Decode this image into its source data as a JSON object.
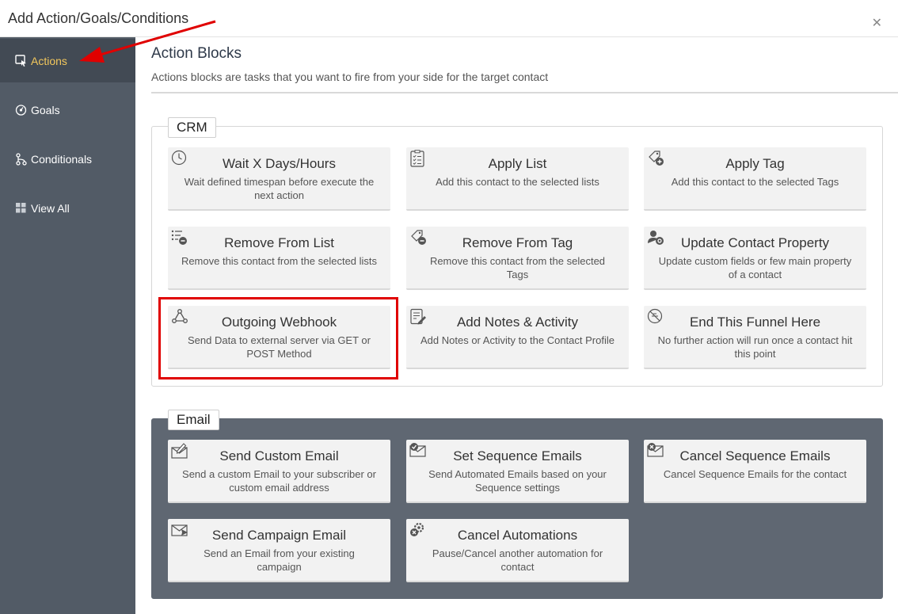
{
  "window": {
    "title": "Add Action/Goals/Conditions",
    "close_icon": "close-icon"
  },
  "sidebar": {
    "items": [
      {
        "label": "Actions",
        "icon": "action-icon",
        "active": true
      },
      {
        "label": "Goals",
        "icon": "goal-icon",
        "active": false
      },
      {
        "label": "Conditionals",
        "icon": "conditional-icon",
        "active": false
      },
      {
        "label": "View All",
        "icon": "grid-icon",
        "active": false
      }
    ]
  },
  "main": {
    "title": "Action Blocks",
    "subtitle": "Actions blocks are tasks that you want to fire from your side for the target contact"
  },
  "crm": {
    "legend": "CRM",
    "cards": [
      {
        "title": "Wait X Days/Hours",
        "desc": "Wait defined timespan before execute the next action",
        "icon": "clock-icon"
      },
      {
        "title": "Apply List",
        "desc": "Add this contact to the selected lists",
        "icon": "clipboard-list-icon"
      },
      {
        "title": "Apply Tag",
        "desc": "Add this contact to the selected Tags",
        "icon": "tag-add-icon"
      },
      {
        "title": "Remove From List",
        "desc": "Remove this contact from the selected lists",
        "icon": "list-remove-icon"
      },
      {
        "title": "Remove From Tag",
        "desc": "Remove this contact from the selected Tags",
        "icon": "tag-remove-icon"
      },
      {
        "title": "Update Contact Property",
        "desc": "Update custom fields or few main property of a contact",
        "icon": "user-settings-icon"
      },
      {
        "title": "Outgoing Webhook",
        "desc": "Send Data to external server via GET or POST Method",
        "icon": "webhook-icon"
      },
      {
        "title": "Add Notes & Activity",
        "desc": "Add Notes or Activity to the Contact Profile",
        "icon": "note-edit-icon"
      },
      {
        "title": "End This Funnel Here",
        "desc": "No further action will run once a contact hit this point",
        "icon": "stop-icon"
      }
    ]
  },
  "email": {
    "legend": "Email",
    "cards": [
      {
        "title": "Send Custom Email",
        "desc": "Send a custom Email to your subscriber or custom email address",
        "icon": "email-edit-icon"
      },
      {
        "title": "Set Sequence Emails",
        "desc": "Send Automated Emails based on your Sequence settings",
        "icon": "email-check-icon"
      },
      {
        "title": "Cancel Sequence Emails",
        "desc": "Cancel Sequence Emails for the contact",
        "icon": "email-cancel-icon"
      },
      {
        "title": "Send Campaign Email",
        "desc": "Send an Email from your existing campaign",
        "icon": "email-send-icon"
      },
      {
        "title": "Cancel Automations",
        "desc": "Pause/Cancel another automation for contact",
        "icon": "automation-cancel-icon"
      }
    ]
  },
  "annotations": {
    "highlight_color": "#e00000",
    "arrow_color": "#e00000"
  },
  "colors": {
    "sidebar_bg": "#525b66",
    "sidebar_active_bg": "#424a54",
    "active_text": "#f2c75c",
    "email_section_bg": "#5f6772",
    "card_bg": "#f2f2f2"
  }
}
